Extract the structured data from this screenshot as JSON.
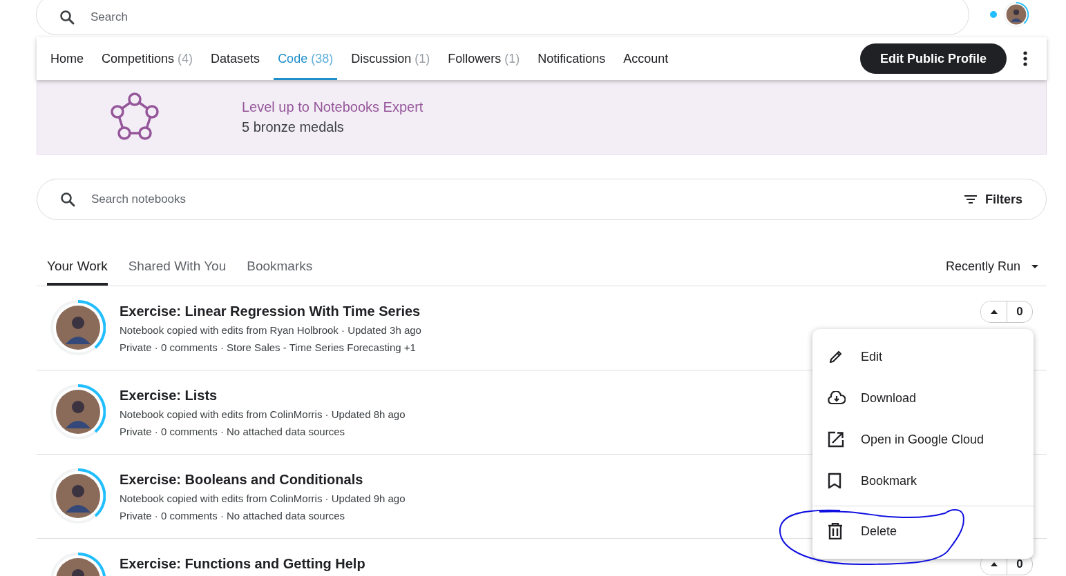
{
  "top_search": {
    "placeholder": "Search"
  },
  "profile_nav": {
    "tabs": [
      {
        "label": "Home",
        "selected": false
      },
      {
        "label": "Competitions",
        "count": "(4)",
        "selected": false
      },
      {
        "label": "Datasets",
        "selected": false
      },
      {
        "label": "Code",
        "count": "(38)",
        "selected": true
      },
      {
        "label": "Discussion",
        "count": "(1)",
        "selected": false
      },
      {
        "label": "Followers",
        "count": "(1)",
        "selected": false
      },
      {
        "label": "Notifications",
        "selected": false
      },
      {
        "label": "Account",
        "selected": false
      }
    ],
    "edit_button": "Edit Public Profile"
  },
  "banner": {
    "title": "Level up to Notebooks Expert",
    "subtitle": "5 bronze medals"
  },
  "notebook_search": {
    "placeholder": "Search notebooks",
    "filters": "Filters"
  },
  "work_tabs": [
    {
      "label": "Your Work",
      "selected": true
    },
    {
      "label": "Shared With You",
      "selected": false
    },
    {
      "label": "Bookmarks",
      "selected": false
    }
  ],
  "sort": "Recently Run",
  "notebooks": [
    {
      "title": "Exercise: Linear Regression With Time Series",
      "line1": "Notebook copied with edits from Ryan Holbrook · Updated 3h ago",
      "line2": "Private · 0 comments · Store Sales - Time Series Forecasting +1",
      "votes": "0"
    },
    {
      "title": "Exercise: Lists",
      "line1": "Notebook copied with edits from ColinMorris · Updated 8h ago",
      "line2": "Private · 0 comments · No attached data sources"
    },
    {
      "title": "Exercise: Booleans and Conditionals",
      "line1": "Notebook copied with edits from ColinMorris · Updated 9h ago",
      "line2": "Private · 0 comments · No attached data sources"
    },
    {
      "title": "Exercise: Functions and Getting Help",
      "votes": "0"
    }
  ],
  "context_menu": {
    "groups": [
      [
        {
          "kind": "edit",
          "label": "Edit"
        },
        {
          "kind": "download",
          "label": "Download"
        },
        {
          "kind": "external",
          "label": "Open in Google Cloud"
        },
        {
          "kind": "bookmark",
          "label": "Bookmark"
        }
      ],
      [
        {
          "kind": "delete",
          "label": "Delete"
        }
      ]
    ]
  }
}
